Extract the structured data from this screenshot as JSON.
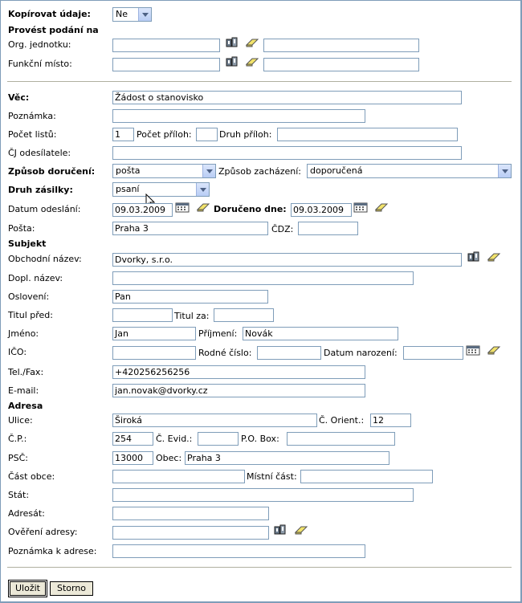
{
  "copy": {
    "label": "Kopírovat údaje:",
    "value": "Ne"
  },
  "perform": {
    "heading": "Provést podání na",
    "org_label": "Org. jednotku:",
    "func_label": "Funkční místo:"
  },
  "doc": {
    "subject_label": "Věc:",
    "subject_value": "Žádost o stanovisko",
    "note_label": "Poznámka:",
    "sheets_label": "Počet listů:",
    "sheets_value": "1",
    "attach_count_label": "Počet příloh:",
    "attach_type_label": "Druh příloh:",
    "sender_ref_label": "ČJ odesílatele:",
    "delivery_label": "Způsob doručení:",
    "delivery_value": "pošta",
    "handling_label": "Způsob zacházení:",
    "handling_value": "doporučená",
    "parcel_label": "Druh zásilky:",
    "parcel_value": "psaní",
    "sent_date_label": "Datum odeslání:",
    "sent_date_value": "09.03.2009",
    "delivered_label": "Doručeno dne:",
    "delivered_value": "09.03.2009",
    "post_label": "Pošta:",
    "post_value": "Praha 3",
    "cdz_label": "ČDZ:"
  },
  "subject": {
    "heading": "Subjekt",
    "company_label": "Obchodní název:",
    "company_value": "Dvorky, s.r.o.",
    "extra_name_label": "Dopl. název:",
    "salutation_label": "Oslovení:",
    "salutation_value": "Pan",
    "title_before_label": "Titul před:",
    "title_after_label": "Titul za:",
    "first_name_label": "Jméno:",
    "first_name_value": "Jan",
    "surname_label": "Příjmení:",
    "surname_value": "Novák",
    "ico_label": "IČO:",
    "birth_no_label": "Rodné číslo:",
    "birth_date_label": "Datum narození:",
    "phone_label": "Tel./Fax:",
    "phone_value": "+420256256256",
    "email_label": "E-mail:",
    "email_value": "jan.novak@dvorky.cz"
  },
  "address": {
    "heading": "Adresa",
    "street_label": "Ulice:",
    "street_value": "Široká",
    "orient_label": "Č. Orient.:",
    "orient_value": "12",
    "cp_label": "Č.P.:",
    "cp_value": "254",
    "evid_label": "Č. Evid.:",
    "pobox_label": "P.O. Box:",
    "zip_label": "PSČ:",
    "zip_value": "13000",
    "city_label": "Obec:",
    "city_value": "Praha 3",
    "city_part_label": "Část obce:",
    "local_part_label": "Místní část:",
    "state_label": "Stát:",
    "addressee_label": "Adresát:",
    "verify_label": "Ověření adresy:",
    "addr_note_label": "Poznámka k adrese:"
  },
  "buttons": {
    "save": "Uložit",
    "cancel": "Storno"
  },
  "colors": {
    "border": "#7f9db9",
    "select_arrow": "#b9cdf5",
    "eraser": "#f2e36b"
  }
}
